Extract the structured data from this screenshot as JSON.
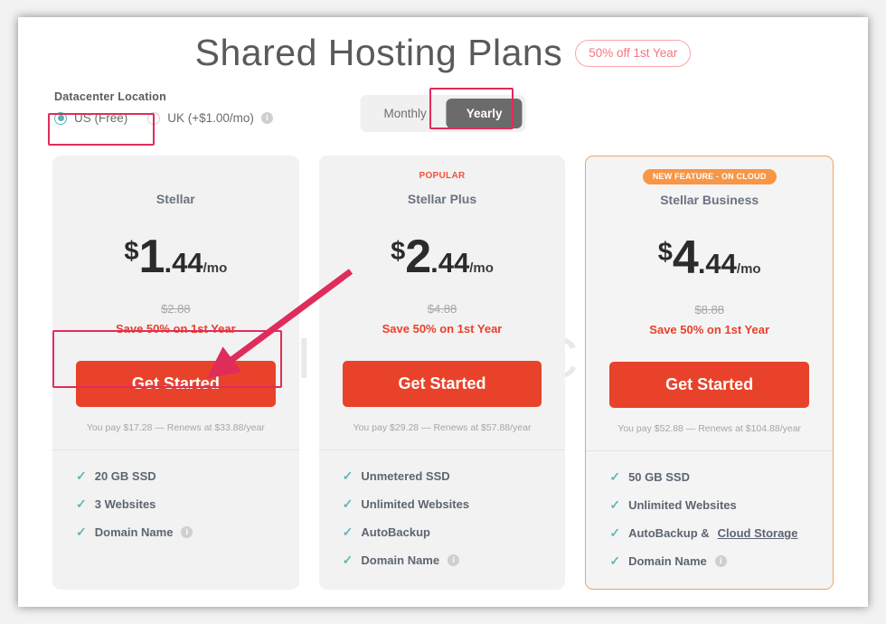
{
  "header": {
    "title": "Shared Hosting Plans",
    "promo_badge": "50% off 1st Year"
  },
  "watermark": "ORIDSITE COM",
  "datacenter": {
    "label": "Datacenter Location",
    "options": [
      {
        "label": "US (Free)",
        "selected": true,
        "info": false
      },
      {
        "label": "UK (+$1.00/mo)",
        "selected": false,
        "info": true
      }
    ]
  },
  "billing": {
    "monthly_label": "Monthly",
    "yearly_label": "Yearly",
    "active": "Yearly"
  },
  "cta_label": "Get Started",
  "plans": [
    {
      "badge": "",
      "badge_type": "none",
      "name": "Stellar",
      "currency": "$",
      "whole": "1",
      "cents": ".44",
      "per": "/mo",
      "old_price": "$2.88",
      "save_line": "Save 50% on 1st Year",
      "renews": "You pay $17.28 — Renews at $33.88/year",
      "features": [
        {
          "text": "20 GB SSD",
          "info": false,
          "underline": ""
        },
        {
          "text": "3 Websites",
          "info": false,
          "underline": ""
        },
        {
          "text": "Domain Name",
          "info": true,
          "underline": ""
        }
      ]
    },
    {
      "badge": "POPULAR",
      "badge_type": "popular",
      "name": "Stellar Plus",
      "currency": "$",
      "whole": "2",
      "cents": ".44",
      "per": "/mo",
      "old_price": "$4.88",
      "save_line": "Save 50% on 1st Year",
      "renews": "You pay $29.28 — Renews at $57.88/year",
      "features": [
        {
          "text": "Unmetered SSD",
          "info": false,
          "underline": ""
        },
        {
          "text": "Unlimited Websites",
          "info": false,
          "underline": ""
        },
        {
          "text": "AutoBackup",
          "info": false,
          "underline": ""
        },
        {
          "text": "Domain Name",
          "info": true,
          "underline": ""
        }
      ]
    },
    {
      "badge": "NEW FEATURE - ON CLOUD",
      "badge_type": "new",
      "name": "Stellar Business",
      "currency": "$",
      "whole": "4",
      "cents": ".44",
      "per": "/mo",
      "old_price": "$8.88",
      "save_line": "Save 50% on 1st Year",
      "renews": "You pay $52.88 — Renews at $104.88/year",
      "features": [
        {
          "text": "50 GB SSD",
          "info": false,
          "underline": ""
        },
        {
          "text": "Unlimited Websites",
          "info": false,
          "underline": ""
        },
        {
          "text": "AutoBackup & ",
          "info": false,
          "underline": "Cloud Storage"
        },
        {
          "text": "Domain Name",
          "info": true,
          "underline": ""
        }
      ]
    }
  ],
  "colors": {
    "cta": "#e8432a",
    "annotation": "#e02c5a",
    "highlight_border": "#f3a25e",
    "check": "#62b8b5",
    "radio": "#5bb3b0",
    "save_text": "#e8412a",
    "badge_new_bg": "#f79646",
    "promo_badge_border": "#f7a6ac"
  }
}
